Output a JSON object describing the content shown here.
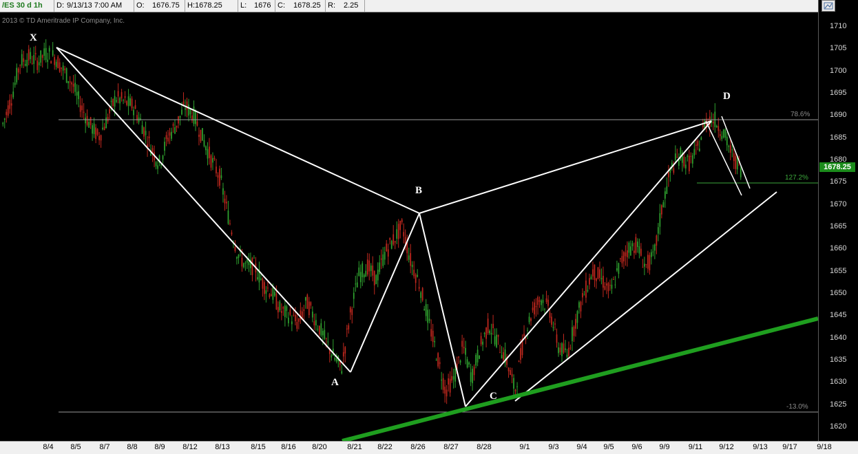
{
  "header": {
    "symbol": "/ES 30 d 1h",
    "date_label": "D:",
    "date_value": "9/13/13 7:00 AM",
    "open_label": "O:",
    "open_value": "1676.75",
    "high_label": "H:",
    "high_value": "1678.25",
    "low_label": "L:",
    "low_value": "1676",
    "close_label": "C:",
    "close_value": "1678.25",
    "range_label": "R:",
    "range_value": "2.25"
  },
  "copyright": "2013 © TD Ameritrade IP Company, Inc.",
  "current_price": "1678.25",
  "fib_labels": {
    "top": "78.6%",
    "mid": "127.2%",
    "bottom": "-13.0%"
  },
  "pattern_points": {
    "x": "X",
    "a": "A",
    "b": "B",
    "c": "C",
    "d": "D"
  },
  "colors": {
    "up_candle": "#2fa12f",
    "down_candle": "#c0281e",
    "pattern_lines": "#ffffff",
    "trendline": "#1f9e1f",
    "price_tag": "#1c8c1c"
  },
  "chart_data": {
    "type": "candlestick",
    "ylim": [
      1617,
      1713
    ],
    "yticks": [
      "1710",
      "1705",
      "1700",
      "1695",
      "1690",
      "1685",
      "1680",
      "1675",
      "1670",
      "1665",
      "1660",
      "1655",
      "1650",
      "1645",
      "1640",
      "1635",
      "1630",
      "1625",
      "1620"
    ],
    "xticks": [
      "8/4",
      "8/5",
      "8/7",
      "8/8",
      "8/9",
      "8/12",
      "8/13",
      "8/15",
      "8/16",
      "8/20",
      "8/21",
      "8/22",
      "8/26",
      "8/27",
      "8/28",
      "9/1",
      "9/3",
      "9/4",
      "9/5",
      "9/6",
      "9/9",
      "9/11",
      "9/12",
      "9/13",
      "9/17",
      "9/18"
    ],
    "harmonic_pattern": [
      {
        "point": "X",
        "price": 1705.5
      },
      {
        "point": "A",
        "price": 1632
      },
      {
        "point": "B",
        "price": 1668
      },
      {
        "point": "C",
        "price": 1624
      },
      {
        "point": "D",
        "price": 1689
      }
    ],
    "fib_levels": [
      {
        "label": "78.6%",
        "price": 1689
      },
      {
        "label": "127.2%",
        "price": 1674.5
      },
      {
        "label": "-13.0%",
        "price": 1623.2
      }
    ],
    "price_path": [
      [
        0,
        1688
      ],
      [
        1,
        1694
      ],
      [
        2,
        1702
      ],
      [
        3,
        1703
      ],
      [
        4,
        1702
      ],
      [
        5,
        1704
      ],
      [
        6,
        1703
      ],
      [
        7,
        1700
      ],
      [
        8,
        1697
      ],
      [
        9,
        1692
      ],
      [
        10,
        1688
      ],
      [
        11,
        1685
      ],
      [
        12,
        1689
      ],
      [
        13,
        1694
      ],
      [
        14,
        1693
      ],
      [
        15,
        1692
      ],
      [
        16,
        1688
      ],
      [
        17,
        1683
      ],
      [
        18,
        1679
      ],
      [
        19,
        1685
      ],
      [
        20,
        1688
      ],
      [
        21,
        1692
      ],
      [
        22,
        1690
      ],
      [
        23,
        1685
      ],
      [
        24,
        1680
      ],
      [
        25,
        1676
      ],
      [
        26,
        1667
      ],
      [
        27,
        1659
      ],
      [
        28,
        1656
      ],
      [
        29,
        1656
      ],
      [
        30,
        1652
      ],
      [
        31,
        1650
      ],
      [
        32,
        1646
      ],
      [
        33,
        1645
      ],
      [
        34,
        1643
      ],
      [
        35,
        1648
      ],
      [
        36,
        1644
      ],
      [
        37,
        1640
      ],
      [
        38,
        1636
      ],
      [
        39,
        1633
      ],
      [
        40,
        1645
      ],
      [
        41,
        1654
      ],
      [
        42,
        1656
      ],
      [
        43,
        1653
      ],
      [
        44,
        1659
      ],
      [
        45,
        1662
      ],
      [
        46,
        1665
      ],
      [
        47,
        1657
      ],
      [
        48,
        1652
      ],
      [
        49,
        1644
      ],
      [
        50,
        1636
      ],
      [
        51,
        1628
      ],
      [
        52,
        1631
      ],
      [
        53,
        1638
      ],
      [
        54,
        1631
      ],
      [
        55,
        1638
      ],
      [
        56,
        1643
      ],
      [
        57,
        1639
      ],
      [
        58,
        1635
      ],
      [
        59,
        1628
      ],
      [
        60,
        1640
      ],
      [
        61,
        1646
      ],
      [
        62,
        1649
      ],
      [
        63,
        1646
      ],
      [
        64,
        1638
      ],
      [
        65,
        1636
      ],
      [
        66,
        1644
      ],
      [
        67,
        1650
      ],
      [
        68,
        1655
      ],
      [
        69,
        1653
      ],
      [
        70,
        1650
      ],
      [
        71,
        1656
      ],
      [
        72,
        1660
      ],
      [
        73,
        1661
      ],
      [
        74,
        1656
      ],
      [
        75,
        1658
      ],
      [
        76,
        1670
      ],
      [
        77,
        1678
      ],
      [
        78,
        1681
      ],
      [
        79,
        1679
      ],
      [
        80,
        1682
      ],
      [
        81,
        1689
      ],
      [
        82,
        1689
      ],
      [
        83,
        1686
      ],
      [
        84,
        1681
      ],
      [
        85,
        1678
      ]
    ]
  }
}
